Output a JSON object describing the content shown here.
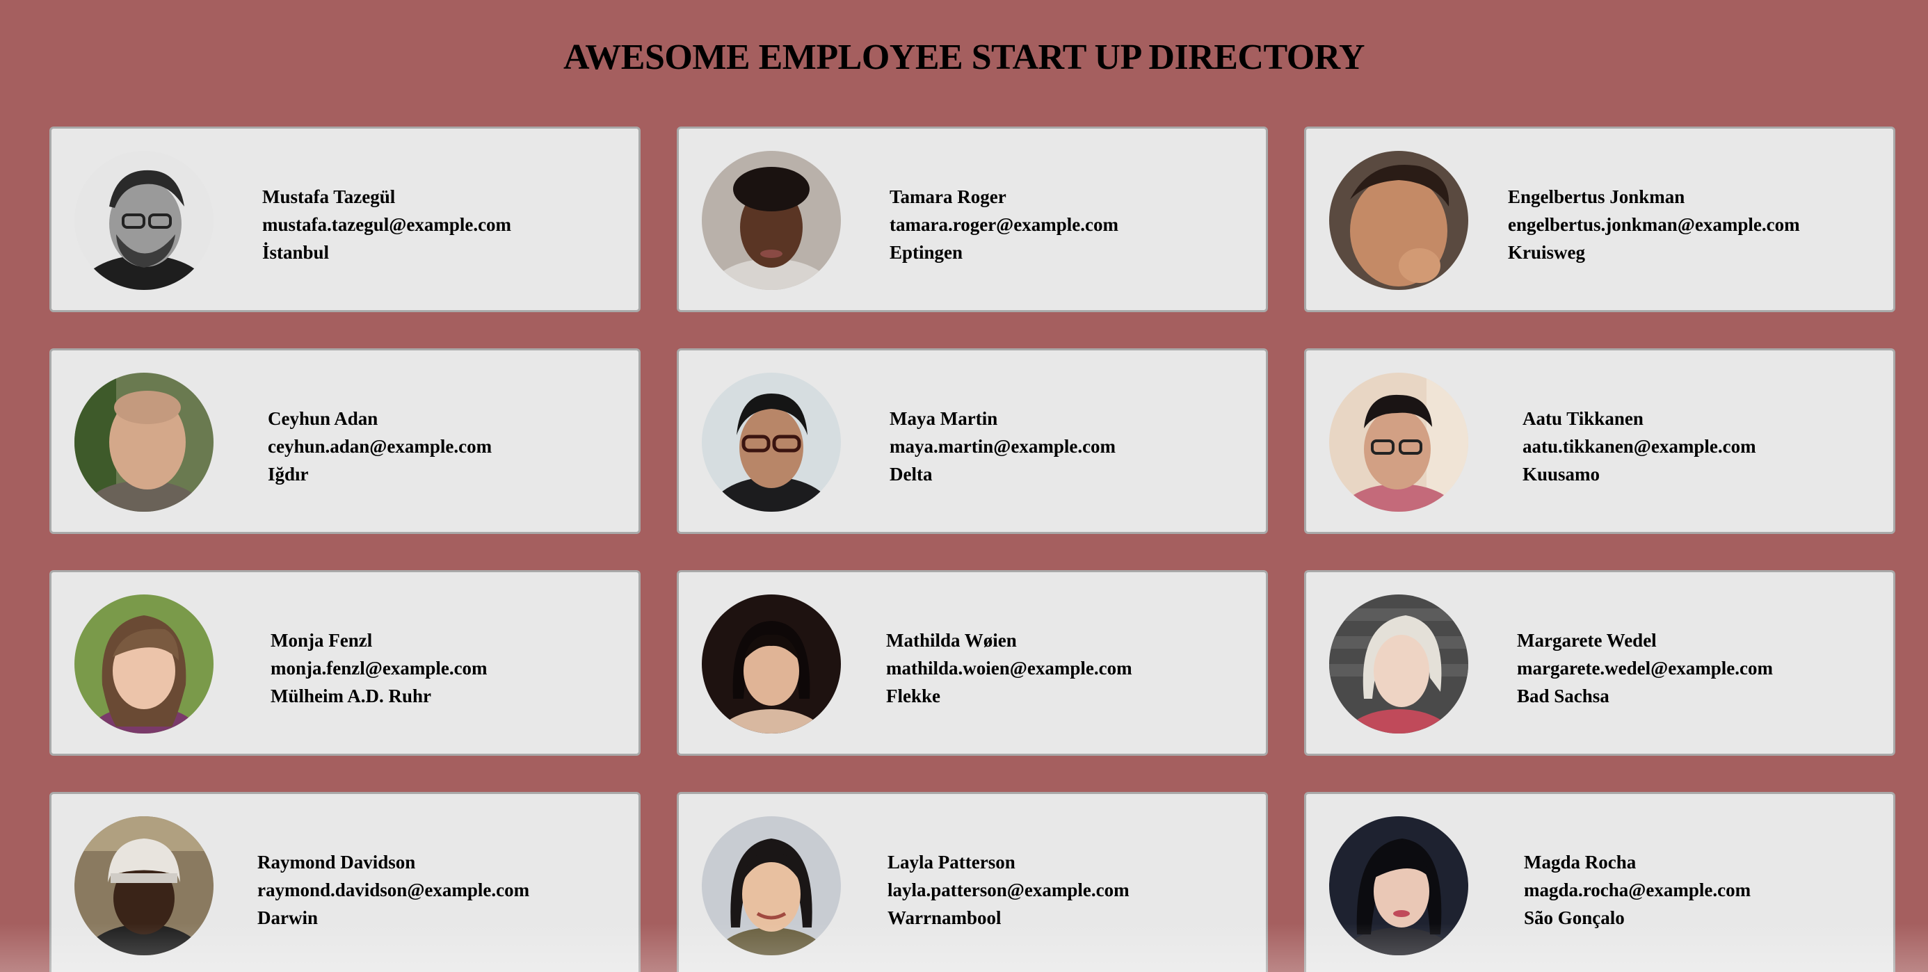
{
  "page": {
    "title": "AWESOME EMPLOYEE START UP DIRECTORY"
  },
  "colors": {
    "background": "#a55f5f",
    "card": "#e8e8e8",
    "card_border": "#a9a9a9"
  },
  "employees": [
    {
      "name": "Mustafa Tazegül",
      "email": "mustafa.tazegul@example.com",
      "city": "İstanbul",
      "photo": "portrait-photo"
    },
    {
      "name": "Tamara Roger",
      "email": "tamara.roger@example.com",
      "city": "Eptingen",
      "photo": "portrait-photo"
    },
    {
      "name": "Engelbertus Jonkman",
      "email": "engelbertus.jonkman@example.com",
      "city": "Kruisweg",
      "photo": "portrait-photo"
    },
    {
      "name": "Ceyhun Adan",
      "email": "ceyhun.adan@example.com",
      "city": "Iğdır",
      "photo": "portrait-photo"
    },
    {
      "name": "Maya Martin",
      "email": "maya.martin@example.com",
      "city": "Delta",
      "photo": "portrait-photo"
    },
    {
      "name": "Aatu Tikkanen",
      "email": "aatu.tikkanen@example.com",
      "city": "Kuusamo",
      "photo": "portrait-photo"
    },
    {
      "name": "Monja Fenzl",
      "email": "monja.fenzl@example.com",
      "city": "Mülheim A.D. Ruhr",
      "photo": "portrait-photo"
    },
    {
      "name": "Mathilda Wøien",
      "email": "mathilda.woien@example.com",
      "city": "Flekke",
      "photo": "portrait-photo"
    },
    {
      "name": "Margarete Wedel",
      "email": "margarete.wedel@example.com",
      "city": "Bad Sachsa",
      "photo": "portrait-photo"
    },
    {
      "name": "Raymond Davidson",
      "email": "raymond.davidson@example.com",
      "city": "Darwin",
      "photo": "portrait-photo"
    },
    {
      "name": "Layla Patterson",
      "email": "layla.patterson@example.com",
      "city": "Warrnambool",
      "photo": "portrait-photo"
    },
    {
      "name": "Magda Rocha",
      "email": "magda.rocha@example.com",
      "city": "São Gonçalo",
      "photo": "portrait-photo"
    }
  ]
}
